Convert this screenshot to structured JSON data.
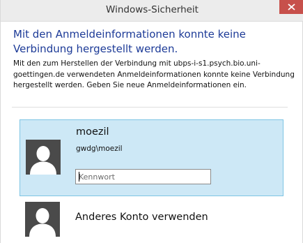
{
  "window": {
    "title": "Windows-Sicherheit",
    "close_icon": "close-icon"
  },
  "dialog": {
    "heading": "Mit den Anmeldeinformationen konnte keine Verbindung hergestellt werden.",
    "message": "Mit den zum Herstellen der Verbindung mit ubps-i-s1.psych.bio.uni-goettingen.de verwendeten Anmeldeinformationen konnte keine Verbindung hergestellt werden. Geben Sie neue Anmeldeinformationen ein."
  },
  "accounts": [
    {
      "name": "moezil",
      "domain_user": "gwdg\\moezil",
      "password_value": "",
      "password_placeholder": "Kennwort",
      "avatar_icon": "user-avatar-icon",
      "selected": true
    },
    {
      "label": "Anderes Konto verwenden",
      "avatar_icon": "user-avatar-icon",
      "selected": false
    }
  ],
  "colors": {
    "heading": "#1c3a97",
    "selected_tile_bg": "#cde8f6",
    "selected_tile_border": "#7ec4e4",
    "close_button": "#c7504b",
    "avatar_bg": "#4a4a4a"
  }
}
